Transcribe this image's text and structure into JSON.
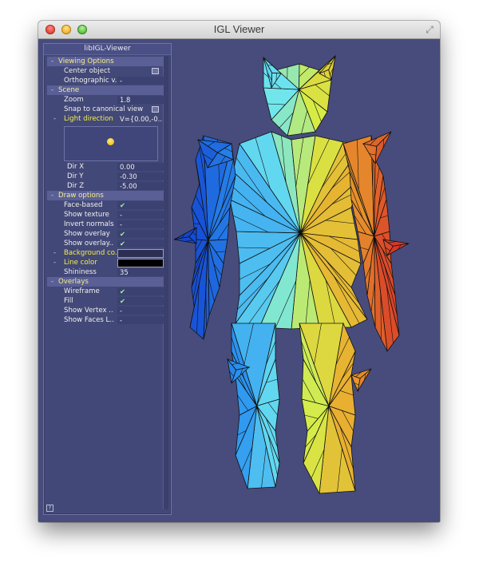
{
  "window": {
    "title": "IGL Viewer"
  },
  "panel": {
    "title": "libIGL-Viewer",
    "help": "?",
    "viewing_options": {
      "label": "Viewing Options",
      "center_object": "Center object",
      "orthographic": "Orthographic v..",
      "orthographic_value": "-"
    },
    "scene": {
      "label": "Scene",
      "zoom_label": "Zoom",
      "zoom_value": "1.8",
      "snap_label": "Snap to canonical view",
      "light_label": "Light direction",
      "light_value": "V={0.00,-0..",
      "dir_x_label": "Dir X",
      "dir_x_value": "0.00",
      "dir_y_label": "Dir Y",
      "dir_y_value": "-0.30",
      "dir_z_label": "Dir Z",
      "dir_z_value": "-5.00"
    },
    "draw_options": {
      "label": "Draw options",
      "face_based": "Face-based",
      "face_based_value": "✔",
      "show_texture": "Show texture",
      "show_texture_value": "-",
      "invert_normals": "Invert normals",
      "invert_normals_value": "-",
      "show_overlay": "Show overlay",
      "show_overlay_value": "✔",
      "show_overlay2": "Show overlay..",
      "show_overlay2_value": "✔",
      "background_color": "Background co..",
      "line_color": "Line color",
      "shininess": "Shininess",
      "shininess_value": "35"
    },
    "overlays": {
      "label": "Overlays",
      "wireframe": "Wireframe",
      "wireframe_value": "✔",
      "fill": "Fill",
      "fill_value": "✔",
      "show_vertex": "Show Vertex ..",
      "show_vertex_value": "-",
      "show_faces": "Show Faces L..",
      "show_faces_value": "-"
    }
  },
  "colors": {
    "background": "#474c7c",
    "accent_yellow": "#f5ef4a",
    "bg_swatch": "#2c2f52",
    "line_swatch": "#000000"
  }
}
